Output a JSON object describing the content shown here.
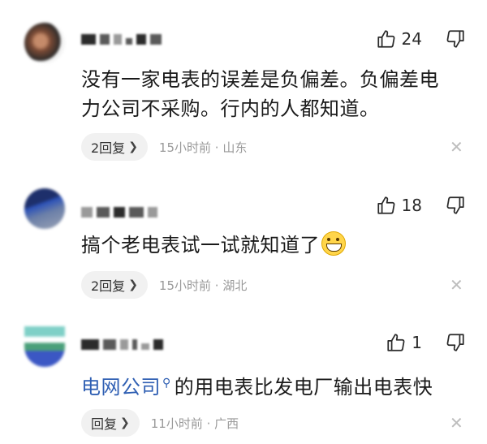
{
  "comments": [
    {
      "likes": "24",
      "text": "没有一家电表的误差是负偏差。负偏差电力公司不采购。行内的人都知道。",
      "reply_label": "2回复",
      "time": "15小时前 · 山东"
    },
    {
      "likes": "18",
      "text": "搞个老电表试一试就知道了",
      "reply_label": "2回复",
      "time": "15小时前 · 湖北"
    },
    {
      "likes": "1",
      "link_text": "电网公司",
      "text": "的用电表比发电厂输出电表快",
      "reply_label": "回复",
      "time": "11小时前 · 广西"
    }
  ],
  "icons": {
    "like": "thumbs-up-outline",
    "dislike": "thumbs-down-outline",
    "close": "close-x",
    "chevron": "chevron-right",
    "search": "search",
    "emoji": "grinning-face"
  },
  "colors": {
    "link": "#2f5fb3",
    "meta": "#9a9a9a",
    "pill_bg": "#f1f1f1"
  }
}
